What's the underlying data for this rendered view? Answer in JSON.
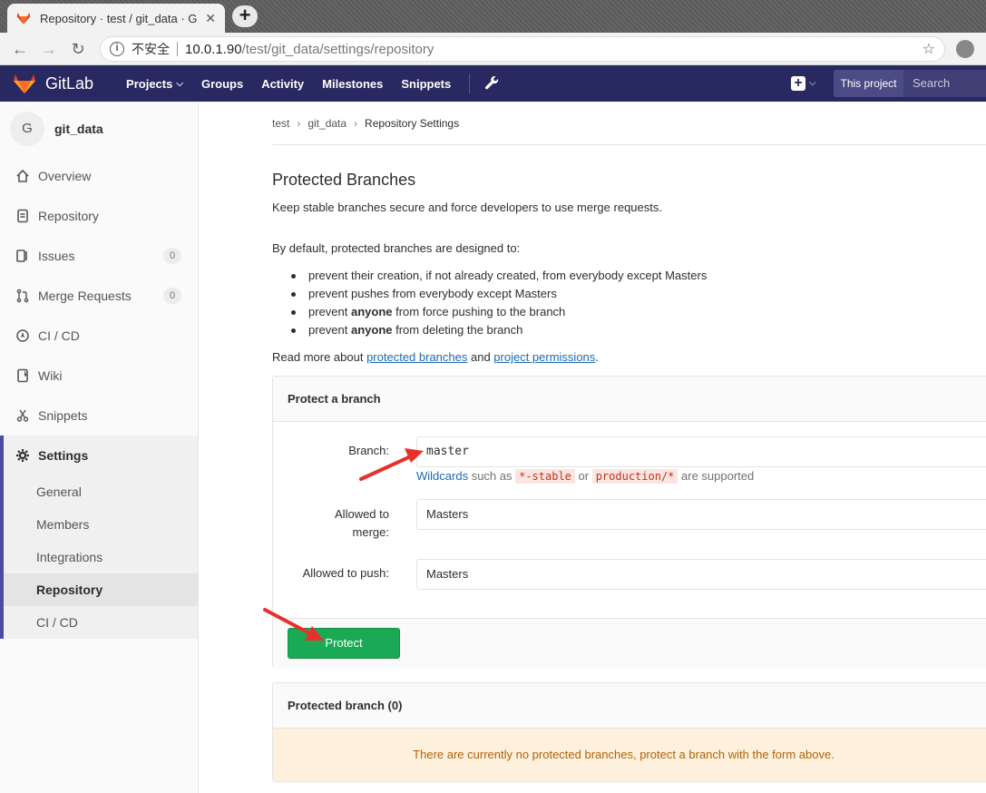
{
  "browser": {
    "tab_title": "Repository · test / git_data · G",
    "tab_close": "✕",
    "new_tab": "+",
    "insecure_label": "不安全",
    "url_host": "10.0.1.90",
    "url_path": "/test/git_data/settings/repository"
  },
  "header": {
    "brand": "GitLab",
    "nav": [
      {
        "label": "Projects"
      },
      {
        "label": "Groups"
      },
      {
        "label": "Activity"
      },
      {
        "label": "Milestones"
      },
      {
        "label": "Snippets"
      }
    ],
    "scope_label": "This project",
    "search_placeholder": "Search",
    "accent": "#292961"
  },
  "sidebar": {
    "avatar_letter": "G",
    "project_name": "git_data",
    "items": [
      {
        "label": "Overview",
        "icon": "home-icon"
      },
      {
        "label": "Repository",
        "icon": "doc-icon"
      },
      {
        "label": "Issues",
        "icon": "issues-icon",
        "count": "0"
      },
      {
        "label": "Merge Requests",
        "icon": "merge-icon",
        "count": "0"
      },
      {
        "label": "CI / CD",
        "icon": "rocket-icon"
      },
      {
        "label": "Wiki",
        "icon": "book-icon"
      },
      {
        "label": "Snippets",
        "icon": "scissors-icon"
      }
    ],
    "settings": {
      "label": "Settings",
      "sub": [
        {
          "label": "General"
        },
        {
          "label": "Members"
        },
        {
          "label": "Integrations"
        },
        {
          "label": "Repository"
        },
        {
          "label": "CI / CD"
        }
      ]
    }
  },
  "breadcrumb": {
    "group": "test",
    "project": "git_data",
    "current": "Repository Settings"
  },
  "content": {
    "title": "Protected Branches",
    "description": "Keep stable branches secure and force developers to use merge requests.",
    "intro": "By default, protected branches are designed to:",
    "bullets": [
      {
        "pre": "prevent their creation, if not already created, from everybody except Masters",
        "bold": "",
        "post": ""
      },
      {
        "pre": "prevent pushes from everybody except Masters",
        "bold": "",
        "post": ""
      },
      {
        "pre": "prevent ",
        "bold": "anyone",
        "post": " from force pushing to the branch"
      },
      {
        "pre": "prevent ",
        "bold": "anyone",
        "post": " from deleting the branch"
      }
    ],
    "read_more": {
      "pre": "Read more about ",
      "link1": "protected branches",
      "mid": " and ",
      "link2": "project permissions",
      "post": "."
    }
  },
  "protect_form": {
    "heading": "Protect a branch",
    "branch_label": "Branch:",
    "branch_value": "master",
    "helper_link": "Wildcards",
    "helper_text1": " such as ",
    "helper_code1": "*-stable",
    "helper_text2": " or ",
    "helper_code2": "production/*",
    "helper_text3": " are supported",
    "merge_label_line1": "Allowed to",
    "merge_label_line2": "merge:",
    "merge_value": "Masters",
    "push_label": "Allowed to push:",
    "push_value": "Masters",
    "submit_label": "Protect",
    "submit_color": "#1aaa55"
  },
  "protected_list": {
    "heading": "Protected branch (0)",
    "empty_message": "There are currently no protected branches, protect a branch with the form above."
  },
  "annotations": {
    "arrow_color": "#e8302a"
  }
}
